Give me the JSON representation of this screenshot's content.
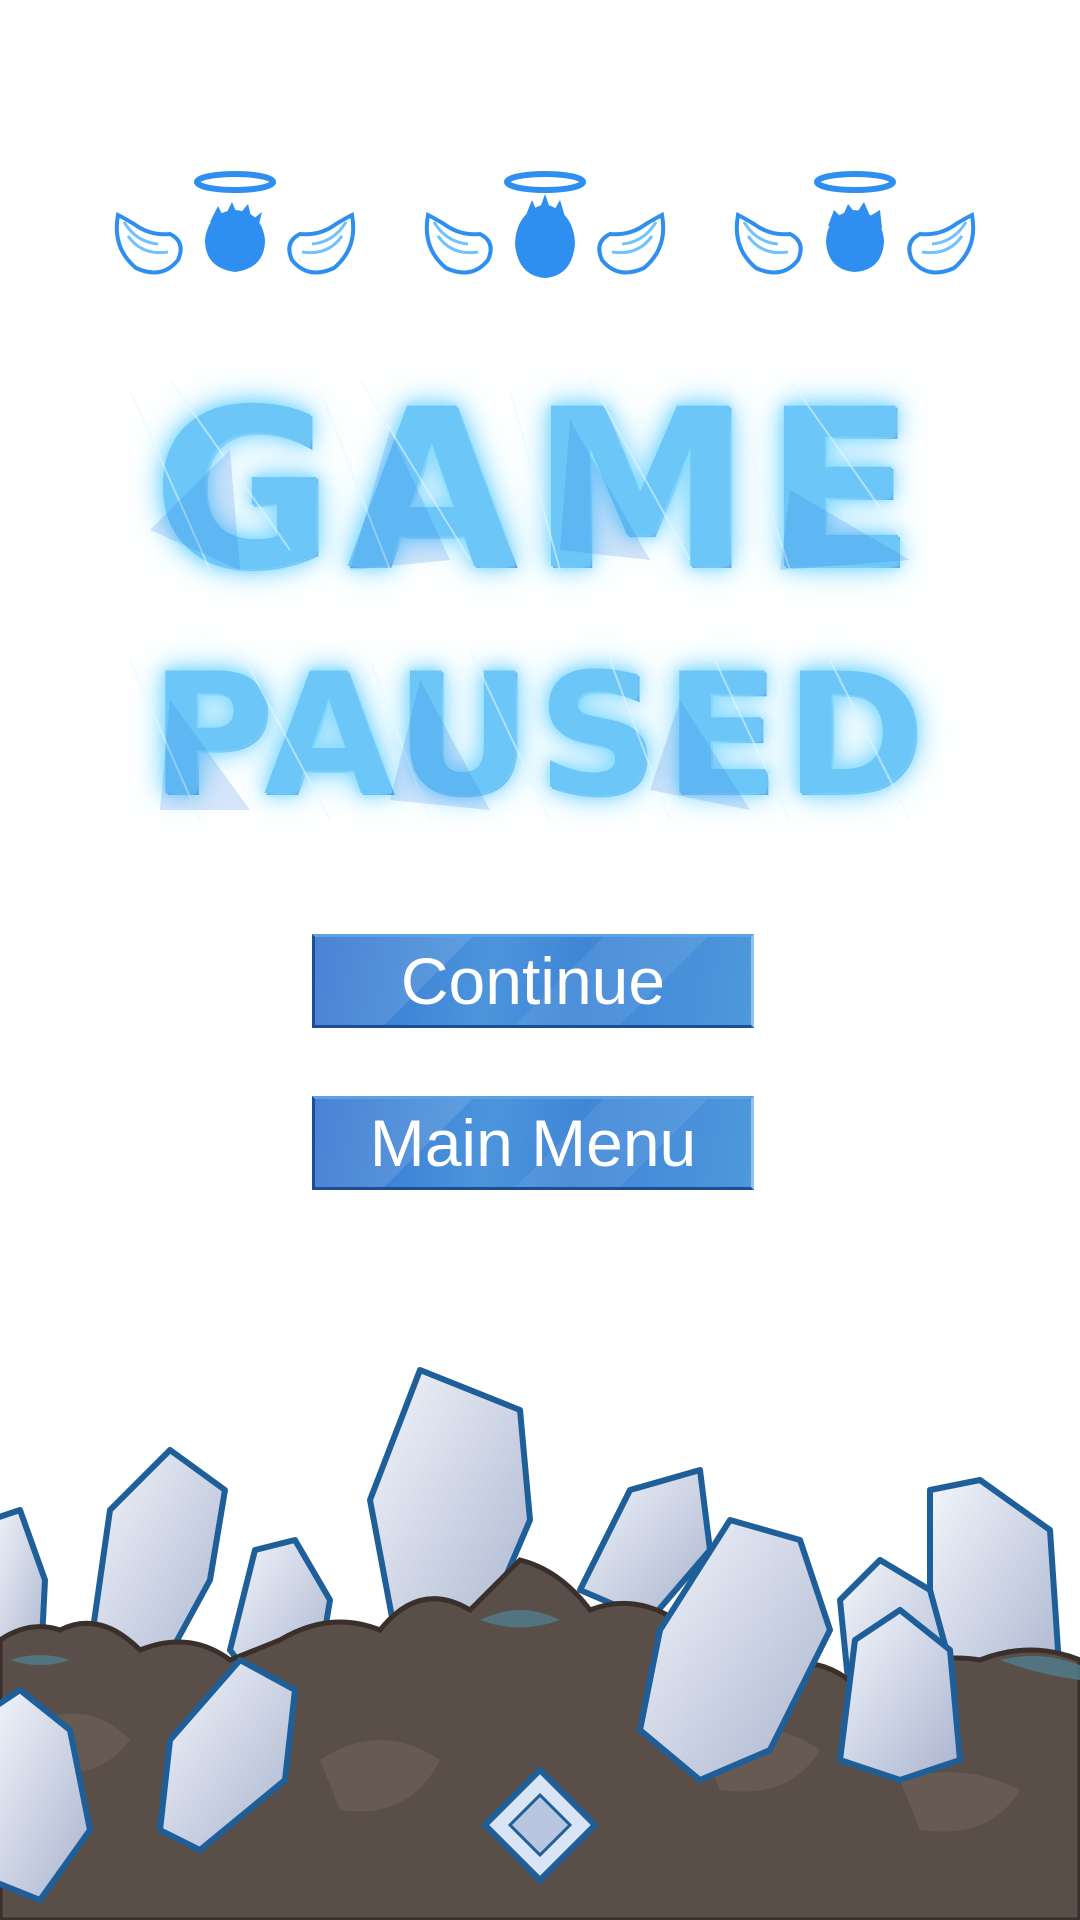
{
  "lives": {
    "count": 3,
    "icon": "angel-head-winged-icon",
    "colors": {
      "primary": "#2f8ff0",
      "light": "#6fc1ff"
    }
  },
  "title": {
    "line1": "GAME",
    "line2": "PAUSED"
  },
  "buttons": {
    "continue_label": "Continue",
    "main_menu_label": "Main Menu"
  },
  "colors": {
    "title_fill": "#6cc6f7",
    "button_fill": "#3f86d6",
    "button_border": "#1d4d94",
    "crystal_stroke": "#1f5f99",
    "rock": "#5a4e49"
  }
}
